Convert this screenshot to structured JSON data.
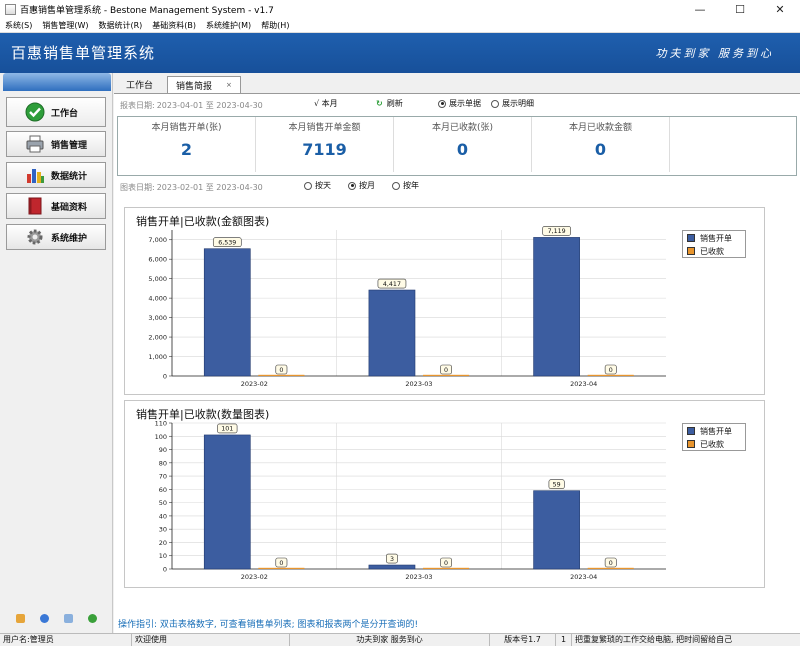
{
  "window": {
    "title": "百惠销售单管理系统 - Bestone Management System - v1.7",
    "controls": [
      "—",
      "☐",
      "✕"
    ]
  },
  "menubar": {
    "items": [
      "系统(S)",
      "销售管理(W)",
      "数据统计(R)",
      "基础资料(B)",
      "系统维护(M)",
      "帮助(H)"
    ]
  },
  "banner": {
    "title": "百惠销售单管理系统",
    "slogan": "功夫到家 服务到心"
  },
  "sidebar": {
    "items": [
      {
        "label": "工作台",
        "icon": "check-circle-icon"
      },
      {
        "label": "销售管理",
        "icon": "printer-icon"
      },
      {
        "label": "数据统计",
        "icon": "bar-chart-icon"
      },
      {
        "label": "基础资料",
        "icon": "book-icon"
      },
      {
        "label": "系统维护",
        "icon": "gear-icon"
      }
    ]
  },
  "tabs": [
    {
      "label": "工作台"
    },
    {
      "label": "销售简报",
      "close": "×"
    }
  ],
  "report_filter": {
    "label": "报表日期:",
    "range": "2023-04-01 至 2023-04-30",
    "this_month": "√ 本月",
    "refresh": "刷新",
    "show_doc": "展示单据",
    "show_detail": "展示明细",
    "selected": "show_doc"
  },
  "summary": [
    {
      "label": "本月销售开单(张)",
      "value": "2"
    },
    {
      "label": "本月销售开单金额",
      "value": "7119"
    },
    {
      "label": "本月已收款(张)",
      "value": "0"
    },
    {
      "label": "本月已收款金额",
      "value": "0"
    }
  ],
  "chart_filter": {
    "label": "图表日期:",
    "range": "2023-02-01 至 2023-04-30",
    "by_day": "按天",
    "by_month": "按月",
    "by_year": "按年",
    "selected": "by_month"
  },
  "colors": {
    "series_open": "#3c5da0",
    "series_paid": "#e8952e",
    "banner": "#1f5fae",
    "value_blue": "#1a5ea6"
  },
  "chart_data": [
    {
      "type": "bar",
      "title": "销售开单|已收款(金额图表)",
      "categories": [
        "2023-02",
        "2023-03",
        "2023-04"
      ],
      "series": [
        {
          "name": "销售开单",
          "values": [
            6539,
            4417,
            7119
          ]
        },
        {
          "name": "已收款",
          "values": [
            0,
            0,
            0
          ]
        }
      ],
      "ylim": [
        0,
        7500
      ],
      "yticks": [
        0,
        1000,
        2000,
        3000,
        4000,
        5000,
        6000,
        7000
      ],
      "data_labels": [
        [
          "6,539",
          "4,417",
          "7,119"
        ],
        [
          "0",
          "0",
          "0"
        ]
      ],
      "legend": "right",
      "grid": true
    },
    {
      "type": "bar",
      "title": "销售开单|已收款(数量图表)",
      "categories": [
        "2023-02",
        "2023-03",
        "2023-04"
      ],
      "series": [
        {
          "name": "销售开单",
          "values": [
            101,
            3,
            59
          ]
        },
        {
          "name": "已收款",
          "values": [
            0,
            0,
            0
          ]
        }
      ],
      "ylim": [
        0,
        110
      ],
      "yticks": [
        0,
        10,
        20,
        30,
        40,
        50,
        60,
        70,
        80,
        90,
        100,
        110
      ],
      "data_labels": [
        [
          "101",
          "3",
          "59"
        ],
        [
          "0",
          "0",
          "0"
        ]
      ],
      "legend": "right",
      "grid": true
    }
  ],
  "hint": "操作指引: 双击表格数字, 可查看销售单列表; 图表和报表两个是分开查询的!",
  "statusbar": [
    "用户名:管理员",
    "欢迎使用",
    "功夫到家 服务到心",
    "版本号1.7",
    "1",
    "把重复繁琐的工作交给电脑, 把时间留给自己"
  ]
}
